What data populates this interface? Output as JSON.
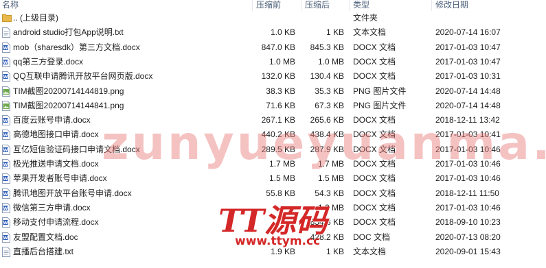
{
  "columns": {
    "name": "名称",
    "compressed": "压缩前",
    "original": "压缩后",
    "type": "类型",
    "modified": "修改日期"
  },
  "files": [
    {
      "name": ".. (上级目录)",
      "compressed": "",
      "original": "",
      "type": "文件夹",
      "modified": "",
      "icon": "folder-icon"
    },
    {
      "name": "android studio打包App说明.txt",
      "compressed": "1.0 KB",
      "original": "1 KB",
      "type": "文本文档",
      "modified": "2020-07-14 16:07",
      "icon": "text-file-icon"
    },
    {
      "name": "mob（sharesdk）第三方文档.docx",
      "compressed": "847.0 KB",
      "original": "845.3 KB",
      "type": "DOCX 文档",
      "modified": "2017-01-03 10:47",
      "icon": "word-file-icon"
    },
    {
      "name": "qq第三方登录.docx",
      "compressed": "1.0 MB",
      "original": "1.0 MB",
      "type": "DOCX 文档",
      "modified": "2017-01-03 10:47",
      "icon": "word-file-icon"
    },
    {
      "name": "QQ互联申请腾讯开放平台网页版.docx",
      "compressed": "132.0 KB",
      "original": "130.4 KB",
      "type": "DOCX 文档",
      "modified": "2017-01-03 10:31",
      "icon": "word-file-icon"
    },
    {
      "name": "TIM截图20200714144819.png",
      "compressed": "38.3 KB",
      "original": "35.3 KB",
      "type": "PNG 图片文件",
      "modified": "2020-07-14 14:48",
      "icon": "image-file-icon"
    },
    {
      "name": "TIM截图20200714144841.png",
      "compressed": "71.6 KB",
      "original": "67.3 KB",
      "type": "PNG 图片文件",
      "modified": "2020-07-14 14:48",
      "icon": "image-file-icon"
    },
    {
      "name": "百度云账号申请.docx",
      "compressed": "267.1 KB",
      "original": "265.6 KB",
      "type": "DOCX 文档",
      "modified": "2018-12-11 13:42",
      "icon": "word-file-icon"
    },
    {
      "name": "高德地图接口申请.docx",
      "compressed": "440.2 KB",
      "original": "438.4 KB",
      "type": "DOCX 文档",
      "modified": "2017-01-03 10:41",
      "icon": "word-file-icon"
    },
    {
      "name": "互亿短信验证码接口申请文档.docx",
      "compressed": "289.5 KB",
      "original": "287.9 KB",
      "type": "DOCX 文档",
      "modified": "2017-01-03 10:46",
      "icon": "word-file-icon"
    },
    {
      "name": "极光推送申请文档.docx",
      "compressed": "1.7 MB",
      "original": "1.7 MB",
      "type": "DOCX 文档",
      "modified": "2017-01-03 10:46",
      "icon": "word-file-icon"
    },
    {
      "name": "苹果开发者账号申请.docx",
      "compressed": "1.5 MB",
      "original": "1.5 MB",
      "type": "DOCX 文档",
      "modified": "2017-01-03 10:46",
      "icon": "word-file-icon"
    },
    {
      "name": "腾讯地图开放平台账号申请.docx",
      "compressed": "55.8 KB",
      "original": "54.3 KB",
      "type": "DOCX 文档",
      "modified": "2018-12-11 11:50",
      "icon": "word-file-icon"
    },
    {
      "name": "微信第三方申请.docx",
      "compressed": "",
      "original": "1.2 MB",
      "type": "DOCX 文档",
      "modified": "2017-01-03 10:46",
      "icon": "word-file-icon"
    },
    {
      "name": "移动支付申请流程.docx",
      "compressed": "",
      "original": "854.3 KB",
      "type": "DOCX 文档",
      "modified": "2018-09-10 10:23",
      "icon": "word-file-icon"
    },
    {
      "name": "友盟配置文档.doc",
      "compressed": "",
      "original": "428.2 KB",
      "type": "DOC 文档",
      "modified": "2020-07-13 08:20",
      "icon": "word-file-icon"
    },
    {
      "name": "直播后台搭建.txt",
      "compressed": "1.9 KB",
      "original": "1 KB",
      "type": "文本文档",
      "modified": "2020-09-01 15:43",
      "icon": "text-file-icon"
    }
  ],
  "watermark": {
    "text": "zunyueyuanma.com",
    "logo": "TT源码",
    "url": "www.ttym.cc",
    "color": "#d42828"
  },
  "colors": {
    "header_text": "#4c607a",
    "word_icon": "#2b5cb8",
    "image_icon": "#6ea84a",
    "folder_icon": "#e8b94a"
  }
}
